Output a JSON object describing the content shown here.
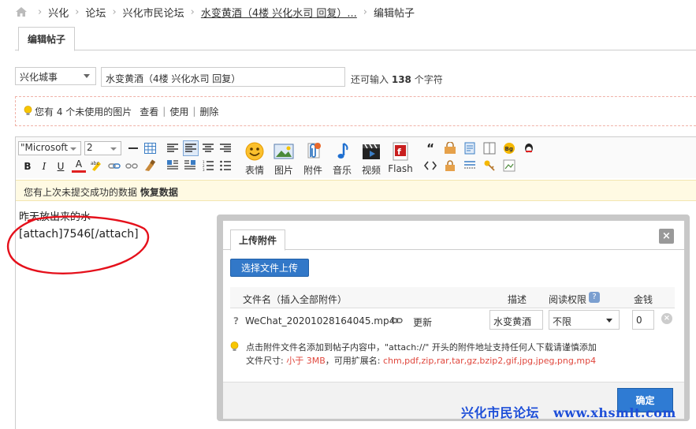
{
  "breadcrumb": {
    "items": [
      "兴化",
      "论坛",
      "兴化市民论坛",
      "水变黄酒（4楼 兴化水司 回复）...",
      "编辑帖子"
    ]
  },
  "tab": {
    "label": "编辑帖子"
  },
  "form": {
    "category_value": "兴化城事",
    "subject_value": "水变黄酒（4楼 兴化水司 回复）",
    "remaining_prefix": "还可输入",
    "remaining_count": "138",
    "remaining_suffix": "个字符"
  },
  "image_bar": {
    "text": "您有 4 个未使用的图片",
    "view": "查看",
    "use": "使用",
    "delete": "删除"
  },
  "toolbar": {
    "font_family": "\"Microsoft",
    "font_size": "2",
    "big_buttons": [
      "表情",
      "图片",
      "附件",
      "音乐",
      "视频",
      "Flash"
    ],
    "bold": "B",
    "italic": "I",
    "underline": "U",
    "color": "A"
  },
  "notice": {
    "text": "您有上次未提交成功的数据",
    "restore": "恢复数据"
  },
  "content": {
    "line1": "昨天放出来的水",
    "line2": "[attach]7546[/attach]"
  },
  "dialog": {
    "tab": "上传附件",
    "upload_button": "选择文件上传",
    "headers": {
      "filename": "文件名（插入全部附件）",
      "desc": "描述",
      "permission": "阅读权限",
      "price": "金钱"
    },
    "row": {
      "qmark": "?",
      "filename": "WeChat_20201028164045.mp4",
      "update": "更新",
      "desc_value": "水变黄酒",
      "permission_value": "不限",
      "price_value": "0"
    },
    "tips": {
      "line1": "点击附件文件名添加到帖子内容中，\"attach://\" 开头的附件地址支持任何人下载请谨慎添加",
      "line2_prefix": "文件尺寸: ",
      "size_limit": "小于 3MB",
      "line2_mid": "，可用扩展名: ",
      "extensions": "chm,pdf,zip,rar,tar,gz,bzip2,gif,jpg,jpeg,png,mp4"
    },
    "ok_button": "确定",
    "close_symbol": "×"
  },
  "watermark": {
    "text": "兴化市民论坛",
    "url": "www.xhsmlt.com"
  },
  "colors": {
    "accent": "#3278c8",
    "annotation_red": "#e5101b",
    "watermark": "#1e4fd8"
  }
}
